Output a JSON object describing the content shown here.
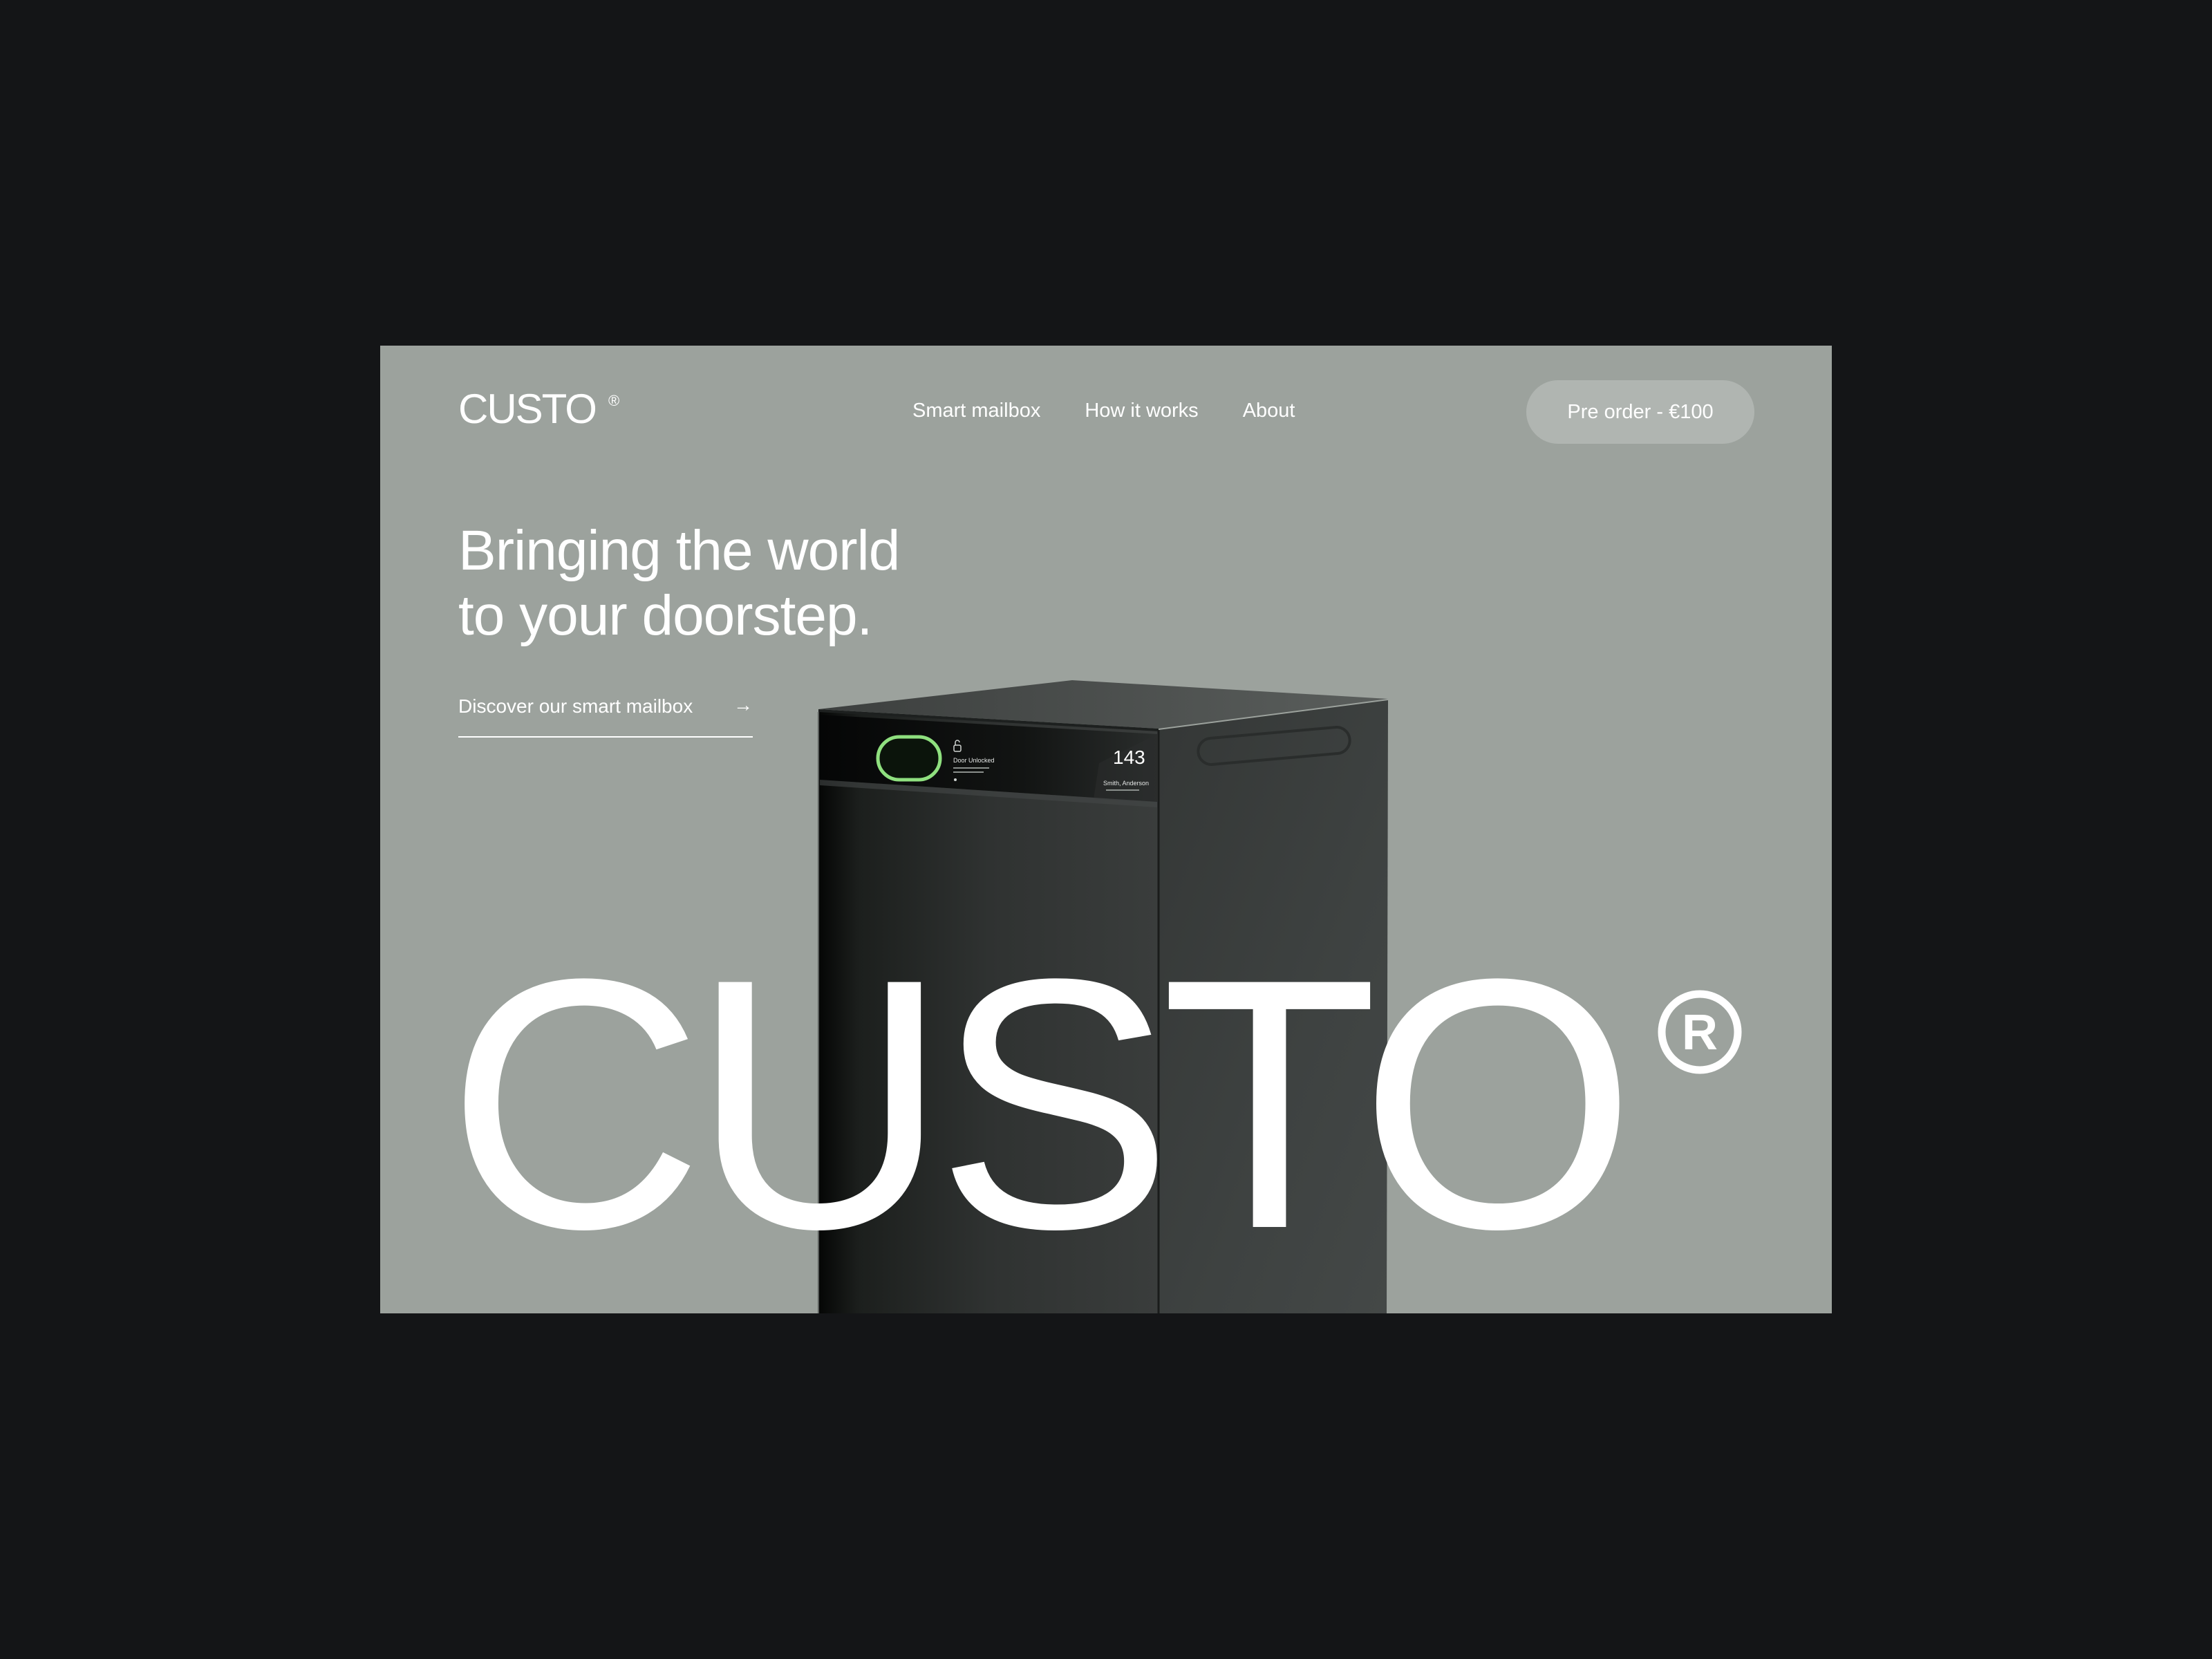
{
  "brand": {
    "logo_text": "CUSTO",
    "registered_mark": "®"
  },
  "nav": {
    "items": [
      {
        "label": "Smart mailbox"
      },
      {
        "label": "How it works"
      },
      {
        "label": "About"
      }
    ],
    "cta_label": "Pre order - €100"
  },
  "hero": {
    "headline_line1": "Bringing the world",
    "headline_line2": "to your doorstep.",
    "link_label": "Discover our smart mailbox",
    "link_arrow": "→",
    "wordmark": "CUSTO",
    "wordmark_mark": "®"
  },
  "product": {
    "screen_number": "143",
    "screen_status": "Door Unlocked",
    "screen_name": "Smith, Anderson",
    "accent_color": "#8fe07f"
  },
  "colors": {
    "page_background": "#141517",
    "frame_background": "#9ca29d",
    "text": "#ffffff",
    "cta_background": "#b0b5b1",
    "mailbox_body": "#2c2e2d"
  }
}
